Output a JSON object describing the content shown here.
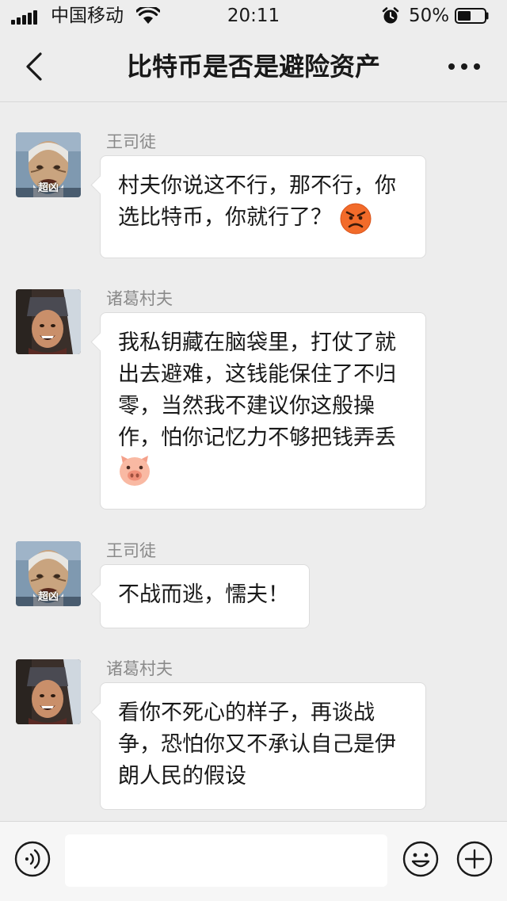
{
  "status_bar": {
    "carrier": "中国移动",
    "time": "20:11",
    "battery_percent": "50%",
    "battery_level": 0.5,
    "icons": [
      "signal-icon",
      "wifi-icon",
      "alarm-icon",
      "battery-icon"
    ]
  },
  "nav": {
    "title": "比特币是否是避险资产",
    "back_icon": "chevron-left-icon",
    "more_icon": "more-dots-icon"
  },
  "messages": [
    {
      "sender": "王司徒",
      "avatar": "avatar-wang",
      "text": "村夫你说这不行，那不行，你选比特币，你就行了？",
      "emoji": "angry-face-emoji"
    },
    {
      "sender": "诸葛村夫",
      "avatar": "avatar-zhuge",
      "text": "我私钥藏在脑袋里，打仗了就出去避难，这钱能保住了不归零，当然我不建议你这般操作，怕你记忆力不够把钱弄丢",
      "emoji": "pig-face-emoji"
    },
    {
      "sender": "王司徒",
      "avatar": "avatar-wang",
      "text": "不战而逃，懦夫！"
    },
    {
      "sender": "诸葛村夫",
      "avatar": "avatar-zhuge",
      "text": "看你不死心的样子，再谈战争，恐怕你又不承认自己是伊朗人民的假设"
    }
  ],
  "avatar_caption": "超凶",
  "input_bar": {
    "value": "",
    "icons": [
      "voice-icon",
      "emoji-icon",
      "plus-icon"
    ]
  },
  "colors": {
    "background": "#ededed",
    "bubble": "#ffffff",
    "sender": "#8a8a8a",
    "text": "#191919"
  }
}
